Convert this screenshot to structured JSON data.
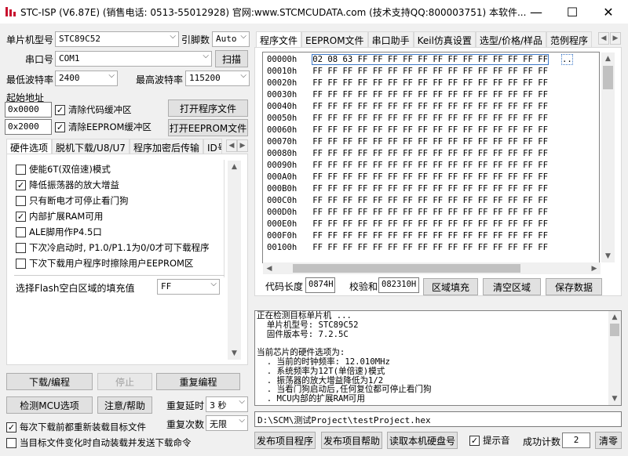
{
  "window": {
    "title": "STC-ISP (V6.87E) (销售电话: 0513-55012928) 官网:www.STCMCUDATA.com  (技术支持QQ:800003751) 本软件...",
    "minimize": "—",
    "maximize": "☐",
    "close": "✕"
  },
  "left": {
    "mcu_label": "单片机型号",
    "mcu_value": "STC89C52",
    "pins_label": "引脚数",
    "pins_value": "Auto",
    "port_label": "串口号",
    "port_value": "COM1",
    "scan_btn": "扫描",
    "min_baud_label": "最低波特率",
    "min_baud_value": "2400",
    "max_baud_label": "最高波特率",
    "max_baud_value": "115200",
    "start_addr_label": "起始地址",
    "addr1": "0x0000",
    "clear_code": "清除代码缓冲区",
    "open_prog": "打开程序文件",
    "addr2": "0x2000",
    "clear_eeprom": "清除EEPROM缓冲区",
    "open_eeprom": "打开EEPROM文件",
    "tabs": [
      "硬件选项",
      "脱机下载/U8/U7",
      "程序加密后传输",
      "ID号"
    ],
    "options": [
      {
        "label": "使能6T(双倍速)模式",
        "checked": false
      },
      {
        "label": "降低振荡器的放大增益",
        "checked": true
      },
      {
        "label": "只有断电才可停止看门狗",
        "checked": false
      },
      {
        "label": "内部扩展RAM可用",
        "checked": true
      },
      {
        "label": "ALE脚用作P4.5口",
        "checked": false
      },
      {
        "label": "下次冷启动时, P1.0/P1.1为0/0才可下载程序",
        "checked": false
      },
      {
        "label": "下次下载用户程序时擦除用户EEPROM区",
        "checked": false
      }
    ],
    "fill_label": "选择Flash空白区域的填充值",
    "fill_value": "FF",
    "download_btn": "下载/编程",
    "stop_btn": "停止",
    "reprogram_btn": "重复编程",
    "check_mcu_btn": "检测MCU选项",
    "help_btn": "注意/帮助",
    "repeat_delay_label": "重复延时",
    "repeat_delay_value": "3 秒",
    "repeat_count_label": "重复次数",
    "repeat_count_value": "无限",
    "reload_each": "每次下载前都重新装载目标文件",
    "reload_each_checked": true,
    "auto_load": "当目标文件变化时自动装载并发送下载命令",
    "auto_load_checked": false
  },
  "right": {
    "tabs": [
      "程序文件",
      "EEPROM文件",
      "串口助手",
      "Keil仿真设置",
      "选型/价格/样品",
      "范例程序"
    ],
    "hex_rows": [
      {
        "addr": "00000h",
        "bytes": "02 08 63 FF FF FF FF FF FF FF FF FF FF FF FF FF",
        "ascii": ".."
      },
      {
        "addr": "00010h",
        "bytes": "FF FF FF FF FF FF FF FF FF FF FF FF FF FF FF FF",
        "ascii": ""
      },
      {
        "addr": "00020h",
        "bytes": "FF FF FF FF FF FF FF FF FF FF FF FF FF FF FF FF",
        "ascii": ""
      },
      {
        "addr": "00030h",
        "bytes": "FF FF FF FF FF FF FF FF FF FF FF FF FF FF FF FF",
        "ascii": ""
      },
      {
        "addr": "00040h",
        "bytes": "FF FF FF FF FF FF FF FF FF FF FF FF FF FF FF FF",
        "ascii": ""
      },
      {
        "addr": "00050h",
        "bytes": "FF FF FF FF FF FF FF FF FF FF FF FF FF FF FF FF",
        "ascii": ""
      },
      {
        "addr": "00060h",
        "bytes": "FF FF FF FF FF FF FF FF FF FF FF FF FF FF FF FF",
        "ascii": ""
      },
      {
        "addr": "00070h",
        "bytes": "FF FF FF FF FF FF FF FF FF FF FF FF FF FF FF FF",
        "ascii": ""
      },
      {
        "addr": "00080h",
        "bytes": "FF FF FF FF FF FF FF FF FF FF FF FF FF FF FF FF",
        "ascii": ""
      },
      {
        "addr": "00090h",
        "bytes": "FF FF FF FF FF FF FF FF FF FF FF FF FF FF FF FF",
        "ascii": ""
      },
      {
        "addr": "000A0h",
        "bytes": "FF FF FF FF FF FF FF FF FF FF FF FF FF FF FF FF",
        "ascii": ""
      },
      {
        "addr": "000B0h",
        "bytes": "FF FF FF FF FF FF FF FF FF FF FF FF FF FF FF FF",
        "ascii": ""
      },
      {
        "addr": "000C0h",
        "bytes": "FF FF FF FF FF FF FF FF FF FF FF FF FF FF FF FF",
        "ascii": ""
      },
      {
        "addr": "000D0h",
        "bytes": "FF FF FF FF FF FF FF FF FF FF FF FF FF FF FF FF",
        "ascii": ""
      },
      {
        "addr": "000E0h",
        "bytes": "FF FF FF FF FF FF FF FF FF FF FF FF FF FF FF FF",
        "ascii": ""
      },
      {
        "addr": "000F0h",
        "bytes": "FF FF FF FF FF FF FF FF FF FF FF FF FF FF FF FF",
        "ascii": ""
      },
      {
        "addr": "00100h",
        "bytes": "FF FF FF FF FF FF FF FF FF FF FF FF FF FF FF FF",
        "ascii": ""
      }
    ],
    "code_len_label": "代码长度",
    "code_len_value": "0874H",
    "checksum_label": "校验和",
    "checksum_value": "082310H",
    "fill_region_btn": "区域填充",
    "clear_region_btn": "清空区域",
    "save_btn": "保存数据",
    "log_lines": [
      "正在检测目标单片机 ...",
      "  单片机型号: STC89C52",
      "  固件版本号: 7.2.5C",
      "",
      "当前芯片的硬件选项为:",
      "  . 当前的时钟频率: 12.010MHz",
      "  . 系统频率为12T(单倍速)模式",
      "  . 振荡器的放大增益降低为1/2",
      "  . 当看门狗启动后,任何复位都可停止看门狗",
      "  . MCU内部的扩展RAM可用"
    ],
    "path": "D:\\SCM\\测试Project\\testProject.hex",
    "publish_btn": "发布项目程序",
    "publish_help_btn": "发布项目帮助",
    "read_disk_btn": "读取本机硬盘号",
    "beep_label": "提示音",
    "beep_checked": true,
    "success_label": "成功计数",
    "success_value": "2",
    "clear_btn": "清零"
  }
}
